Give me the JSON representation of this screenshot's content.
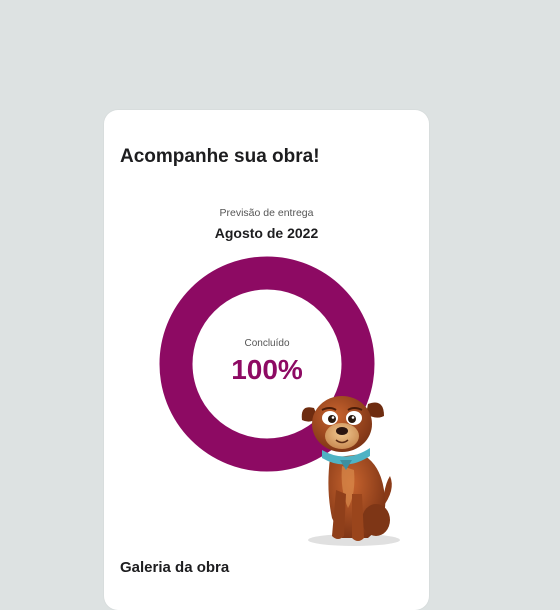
{
  "card": {
    "title": "Acompanhe sua obra!",
    "forecast_label": "Previsão de entrega",
    "forecast_value": "Agosto de 2022",
    "progress": {
      "label": "Concluído",
      "value_text": "100%",
      "percent": 100
    },
    "gallery_title": "Galeria da obra"
  },
  "colors": {
    "accent": "#8d0a63",
    "background": "#dde2e2",
    "card": "#ffffff"
  },
  "mascot": {
    "icon": "dog-mascot-icon"
  }
}
